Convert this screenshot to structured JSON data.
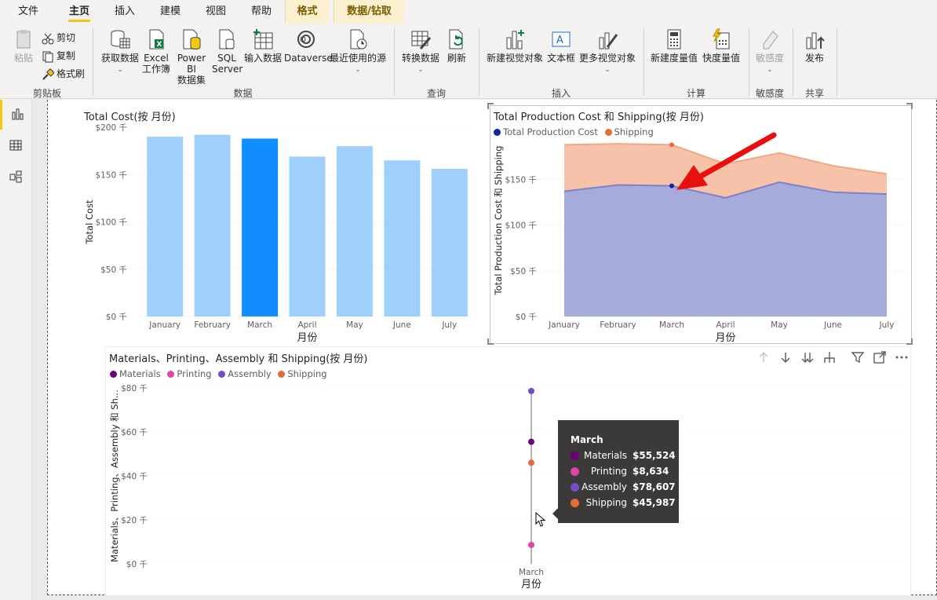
{
  "menu": {
    "tabs": [
      "文件",
      "主页",
      "插入",
      "建模",
      "视图",
      "帮助",
      "格式",
      "数据/钻取"
    ],
    "active": "主页"
  },
  "ribbon": {
    "clipboard": {
      "paste": "粘贴",
      "cut": "剪切",
      "copy": "复制",
      "format_painter": "格式刷",
      "label": "剪贴板"
    },
    "data": {
      "get_data": "获取数据",
      "excel_1": "Excel",
      "excel_2": "工作簿",
      "pbi_1": "Power BI",
      "pbi_2": "数据集",
      "sql_1": "SQL",
      "sql_2": "Server",
      "enter_data": "输入数据",
      "dataverse": "Dataverse",
      "recent": "最近使用的源",
      "label": "数据"
    },
    "query": {
      "transform": "转换数据",
      "refresh": "刷新",
      "label": "查询"
    },
    "insert": {
      "new_visual": "新建视觉对象",
      "textbox": "文本框",
      "more_visuals": "更多视觉对象",
      "label": "插入"
    },
    "calc": {
      "new_measure": "新建度量值",
      "quick_measure": "快度量值",
      "label": "计算"
    },
    "sensitivity": {
      "btn": "敏感度",
      "label": "敏感度"
    },
    "share": {
      "publish": "发布",
      "label": "共享"
    }
  },
  "colors": {
    "accent": "#f2c811",
    "bar_light": "#9fd0fb",
    "bar_selected": "#118dff",
    "production": "#12239e",
    "shipping": "#e66c37",
    "materials": "#6b007b",
    "printing": "#e044a7",
    "assembly": "#744ec2"
  },
  "charts": {
    "total_cost": {
      "title": "Total Cost(按 月份)",
      "ylabel": "Total Cost",
      "xlabel": "月份",
      "yticks": [
        "$200 千",
        "$150 千",
        "$100 千",
        "$50 千",
        "$0 千"
      ]
    },
    "production": {
      "title": "Total Production Cost 和 Shipping(按 月份)",
      "ylabel": "Total Production Cost 和 Shipping",
      "xlabel": "月份",
      "legend": [
        "Total Production Cost",
        "Shipping"
      ],
      "yticks": [
        "$150 千",
        "$100 千",
        "$50 千",
        "$0 千"
      ]
    },
    "materials": {
      "title": "Materials、Printing、Assembly 和 Shipping(按 月份)",
      "ylabel": "Materials、Printing、Assembly 和 Sh...",
      "xlabel": "月份",
      "legend": [
        "Materials",
        "Printing",
        "Assembly",
        "Shipping"
      ],
      "yticks": [
        "$80 千",
        "$60 千",
        "$40 千",
        "$20 千",
        "$0 千"
      ]
    }
  },
  "tooltip": {
    "title": "March",
    "rows": [
      {
        "name": "Materials",
        "value": "$55,524"
      },
      {
        "name": "Printing",
        "value": "$8,634"
      },
      {
        "name": "Assembly",
        "value": "$78,607"
      },
      {
        "name": "Shipping",
        "value": "$45,987"
      }
    ]
  },
  "chart_data": [
    {
      "type": "bar",
      "title": "Total Cost(按 月份)",
      "categories": [
        "January",
        "February",
        "March",
        "April",
        "May",
        "June",
        "July"
      ],
      "values": [
        190,
        192,
        188,
        169,
        180,
        165,
        156
      ],
      "selected": "March",
      "xlabel": "月份",
      "ylabel": "Total Cost",
      "ylim": [
        0,
        200
      ],
      "grid": true
    },
    {
      "type": "area",
      "title": "Total Production Cost 和 Shipping(按 月份)",
      "categories": [
        "January",
        "February",
        "March",
        "April",
        "May",
        "June",
        "July"
      ],
      "series": [
        {
          "name": "Total Production Cost",
          "values": [
            137,
            144,
            143,
            130,
            147,
            136,
            134
          ]
        },
        {
          "name": "Shipping",
          "values": [
            188,
            189,
            188,
            167,
            179,
            165,
            156
          ]
        }
      ],
      "highlight": "March",
      "xlabel": "月份",
      "ylabel": "Total Production Cost 和 Shipping",
      "ylim": [
        0,
        190
      ],
      "legend": "top-left"
    },
    {
      "type": "scatter",
      "title": "Materials、Printing、Assembly 和 Shipping(按 月份)",
      "categories": [
        "March"
      ],
      "series": [
        {
          "name": "Materials",
          "values": [
            55.524
          ]
        },
        {
          "name": "Printing",
          "values": [
            8.634
          ]
        },
        {
          "name": "Assembly",
          "values": [
            78.607
          ]
        },
        {
          "name": "Shipping",
          "values": [
            45.987
          ]
        }
      ],
      "xlabel": "月份",
      "ylabel": "Materials、Printing、Assembly 和 Sh...",
      "ylim": [
        0,
        80
      ],
      "legend": "top-left"
    }
  ]
}
